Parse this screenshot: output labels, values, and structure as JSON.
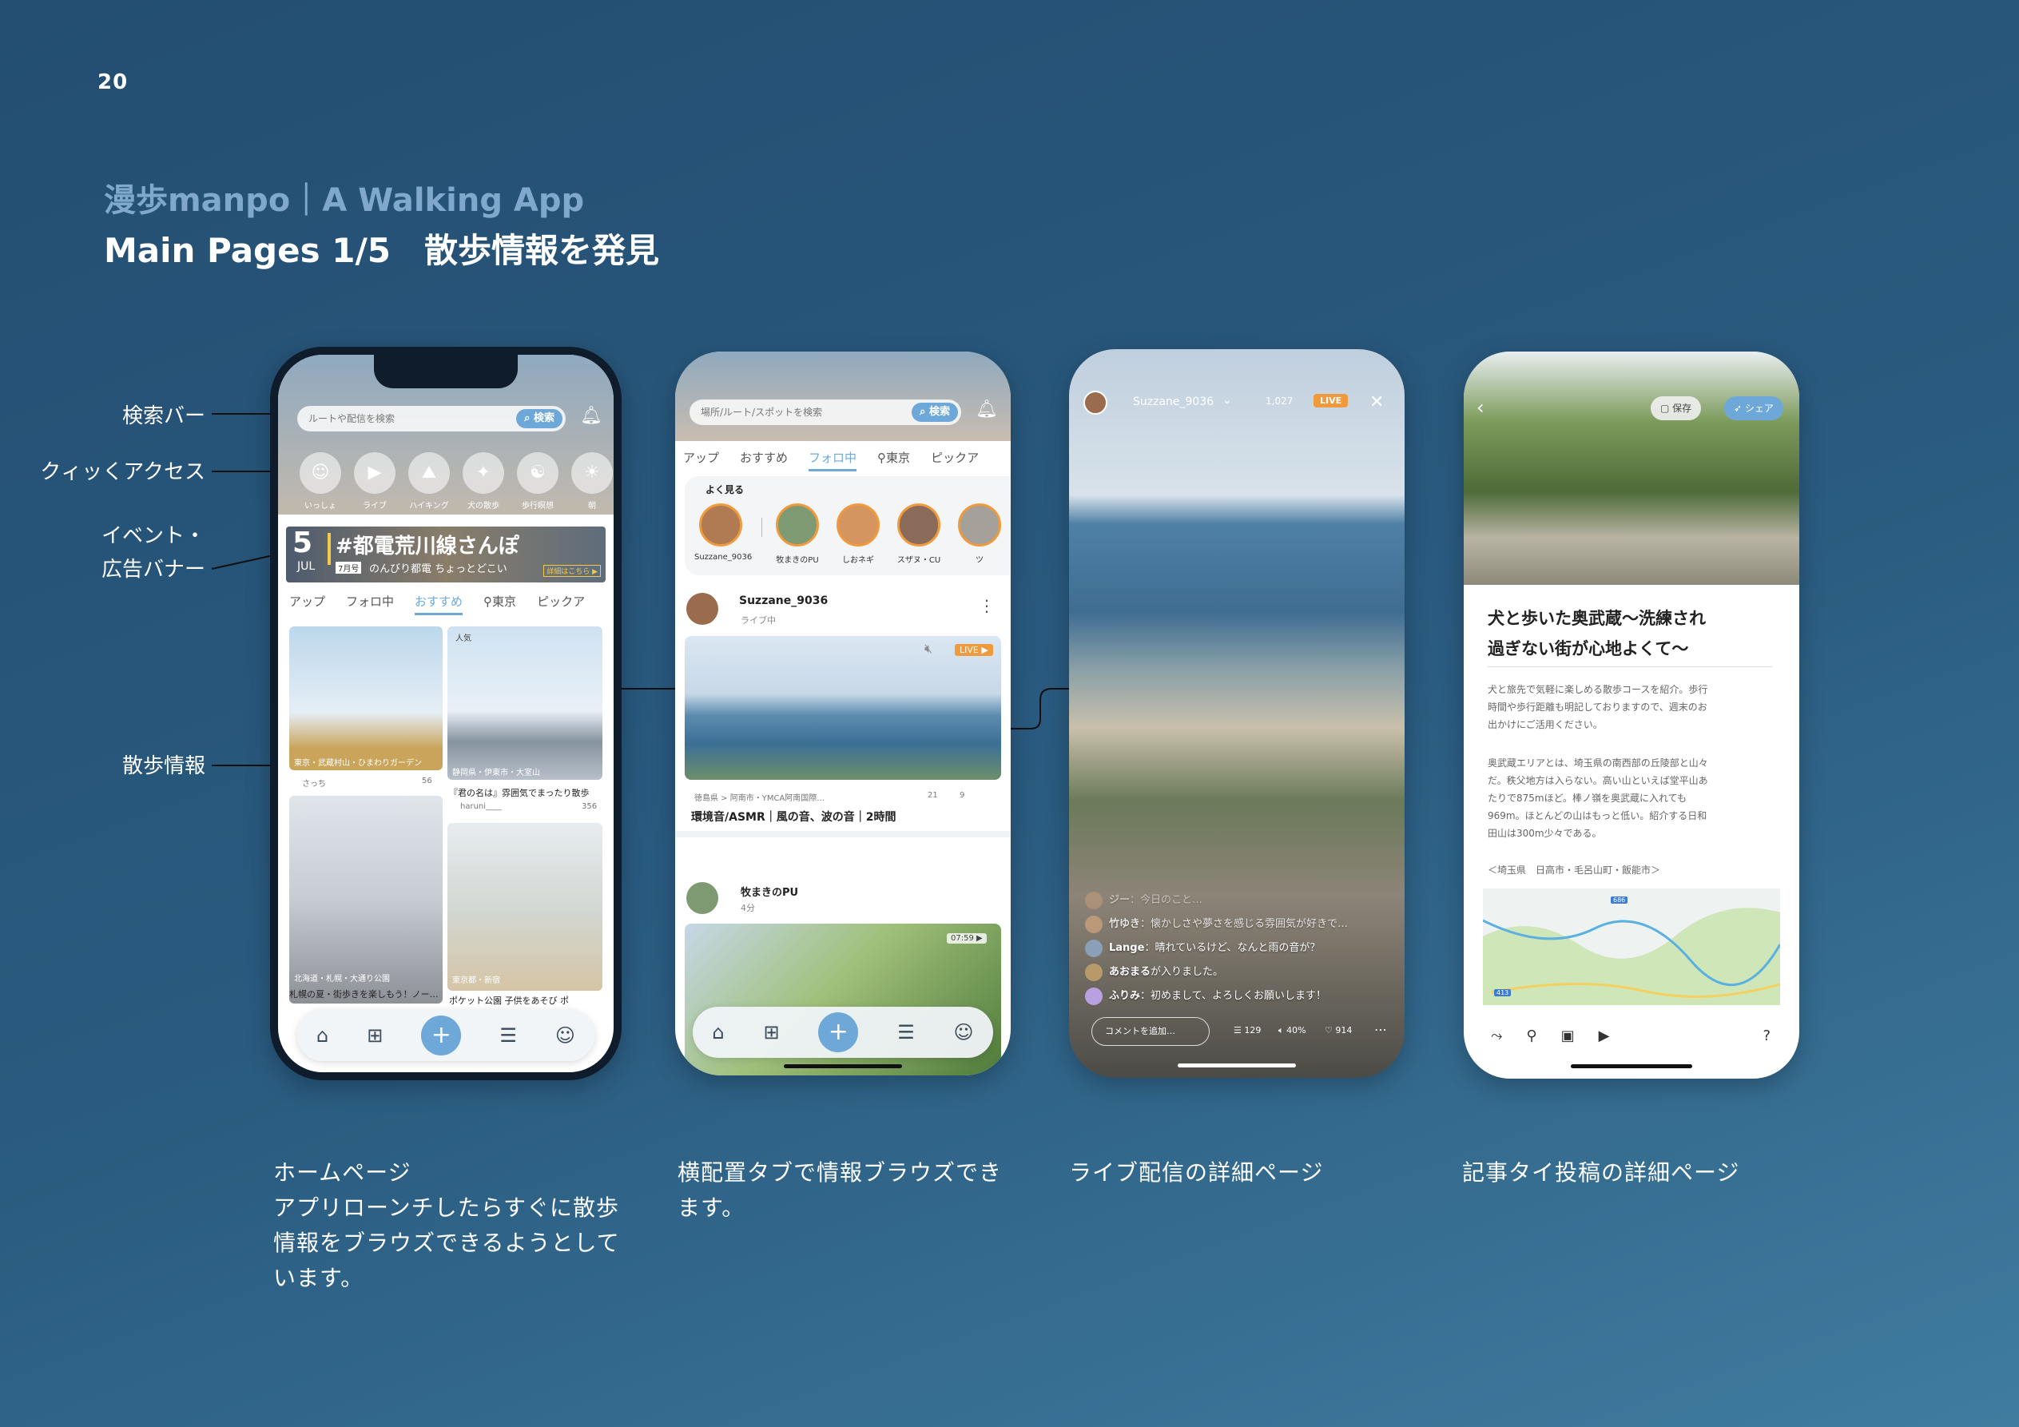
{
  "page_number": "20",
  "subtitle": "漫歩manpo｜A Walking App",
  "title": "Main Pages 1/5　散歩情報を発見",
  "annotations": {
    "search_bar": "検索バー",
    "quick_access": "クィッくアクセス",
    "banner_line1": "イベント・",
    "banner_line2": "広告バナー",
    "walk_info": "散歩情報"
  },
  "descriptions": {
    "home": [
      "ホームページ",
      "アプリローンチしたらすぐに散歩",
      "情報をブラウズできるようとして",
      "います。"
    ],
    "tabs": [
      "横配置タブで情報ブラウズでき",
      "ます。"
    ],
    "live": [
      "ライブ配信の詳細ページ"
    ],
    "article": [
      "記事タイ投稿の詳細ページ"
    ]
  },
  "home_screen": {
    "search_placeholder": "ルートや配信を検索",
    "search_button": "検索",
    "bell_badge": "1",
    "quick_access": [
      {
        "label": "いっしょ",
        "icon": "face-icon"
      },
      {
        "label": "ライブ",
        "icon": "video-icon"
      },
      {
        "label": "ハイキング",
        "icon": "hiking-icon"
      },
      {
        "label": "犬の散歩",
        "icon": "dog-icon"
      },
      {
        "label": "歩行瞑想",
        "icon": "meditation-icon"
      },
      {
        "label": "朝",
        "icon": "sun-icon"
      }
    ],
    "banner": {
      "day": "5",
      "month": "JUL",
      "headline": "#都電荒川線さんぽ",
      "tag": "7月号",
      "sub": "のんびり都電 ちょっとどこい",
      "cta": "詳細はこちら ▶"
    },
    "tabs": [
      "アップ",
      "フォロ中",
      "おすすめ",
      "東京",
      "ピックア"
    ],
    "active_tab": "おすすめ",
    "cards": [
      {
        "location": "東京・武蔵村山・ひまわりガーデン",
        "title": "",
        "user": "さっち",
        "views": "56",
        "badge": ""
      },
      {
        "location": "静岡県・伊東市・大室山",
        "title": "『君の名は』雰囲気でまったり散歩",
        "user": "haruni____",
        "views": "356",
        "badge": "人気"
      },
      {
        "location": "北海道・札幌・大通り公園",
        "title": "札幌の夏・街歩きを楽しもう！ノー…",
        "user": "",
        "views": "",
        "badge": ""
      },
      {
        "location": "東京都・新宿",
        "title": "ポケット公園 子供をあそび ポ",
        "user": "",
        "views": "",
        "badge": ""
      }
    ]
  },
  "follow_screen": {
    "search_placeholder": "場所/ルート/スポットを検索",
    "search_button": "検索",
    "bell_badge": "1",
    "tabs": [
      "アップ",
      "おすすめ",
      "フォロ中",
      "東京",
      "ピックア"
    ],
    "active_tab": "フォロ中",
    "stories_title": "よく見る",
    "stories": [
      "Suzzane_9036",
      "牧まきのPU",
      "しおネギ",
      "スザヌ・CU",
      "ツ"
    ],
    "post1": {
      "user": "Suzzane_9036",
      "status": "ライブ中",
      "live": "LIVE ▶",
      "location": "徳島県 > 阿南市・YMCA阿南国際…",
      "likes": "21",
      "comments": "9",
      "title": "環境音/ASMR｜風の音、波の音｜2時間"
    },
    "post2": {
      "user": "牧まきのPU",
      "time": "4分",
      "duration": "07:59 ▶"
    }
  },
  "live_screen": {
    "user": "Suzzane_9036",
    "viewers": "1,027",
    "live_badge": "LIVE",
    "comments": [
      {
        "name": "ジー",
        "text": "今日のこと…"
      },
      {
        "name": "竹ゆき",
        "text": "懐かしさや夢さを感じる雰囲気が好きで…"
      },
      {
        "name": "Lange",
        "text": "晴れているけど、なんと雨の音が？"
      },
      {
        "name": "あおまる",
        "text": "が入りました。"
      },
      {
        "name": "ふりみ",
        "text": "初めまして、よろしくお願いします！"
      }
    ],
    "comment_placeholder": "コメントを追加…",
    "stat_comments": "129",
    "stat_volume": "40%",
    "stat_likes": "914"
  },
  "article_screen": {
    "save_button": "保存",
    "share_button": "シェア",
    "title_line1": "犬と歩いた奥武蔵〜洗練され",
    "title_line2": "過ぎない街が心地よくて〜",
    "para1": [
      "犬と旅先で気軽に楽しめる散歩コースを紹介。歩行",
      "時間や歩行距離も明記しておりますので、週末のお",
      "出かけにご活用ください。"
    ],
    "para2": [
      "奥武蔵エリアとは、埼玉県の南西部の丘陵部と山々",
      "だ。秩父地方は入らない。高い山といえば堂平山あ",
      "たりで875mほど。棒ノ嶺を奥武蔵に入れても",
      "969m。ほとんどの山はもっと低い。紹介する日和",
      "田山は300m少々である。"
    ],
    "area": "＜埼玉県　日高市・毛呂山町・飯能市＞",
    "map_labels": [
      "686",
      "413"
    ]
  },
  "colors": {
    "accent": "#6ea8d8",
    "live": "#f09a3e",
    "bg_top": "#234e71",
    "bg_bottom": "#3f7c9f"
  }
}
